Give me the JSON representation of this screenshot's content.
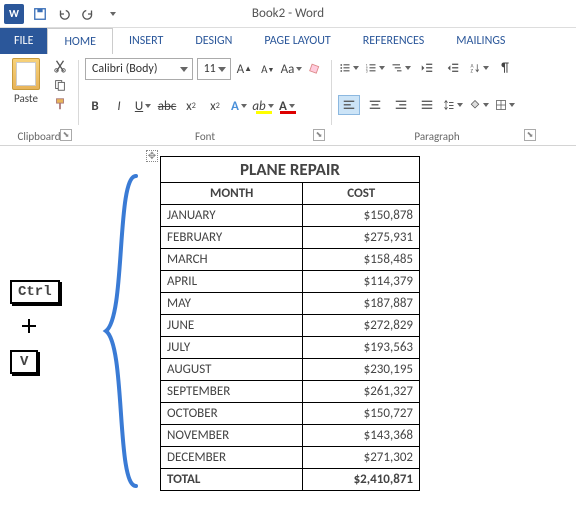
{
  "app": {
    "doc_title": "Book2 - Word"
  },
  "tabs": {
    "file": "FILE",
    "home": "HOME",
    "insert": "INSERT",
    "design": "DESIGN",
    "page_layout": "PAGE LAYOUT",
    "references": "REFERENCES",
    "mailings": "MAILINGS"
  },
  "ribbon": {
    "clipboard": {
      "paste": "Paste",
      "label": "Clipboard"
    },
    "font": {
      "name": "Calibri (Body)",
      "size": "11",
      "label": "Font"
    },
    "paragraph": {
      "label": "Paragraph"
    }
  },
  "keys": {
    "ctrl": "Ctrl",
    "v": "V"
  },
  "table": {
    "title": "PLANE REPAIR",
    "headers": {
      "month": "MONTH",
      "cost": "COST"
    },
    "rows": [
      {
        "month": "JANUARY",
        "cost": "$150,878"
      },
      {
        "month": "FEBRUARY",
        "cost": "$275,931"
      },
      {
        "month": "MARCH",
        "cost": "$158,485"
      },
      {
        "month": "APRIL",
        "cost": "$114,379"
      },
      {
        "month": "MAY",
        "cost": "$187,887"
      },
      {
        "month": "JUNE",
        "cost": "$272,829"
      },
      {
        "month": "JULY",
        "cost": "$193,563"
      },
      {
        "month": "AUGUST",
        "cost": "$230,195"
      },
      {
        "month": "SEPTEMBER",
        "cost": "$261,327"
      },
      {
        "month": "OCTOBER",
        "cost": "$150,727"
      },
      {
        "month": "NOVEMBER",
        "cost": "$143,368"
      },
      {
        "month": "DECEMBER",
        "cost": "$271,302"
      }
    ],
    "total": {
      "label": "TOTAL",
      "value": "$2,410,871"
    }
  }
}
